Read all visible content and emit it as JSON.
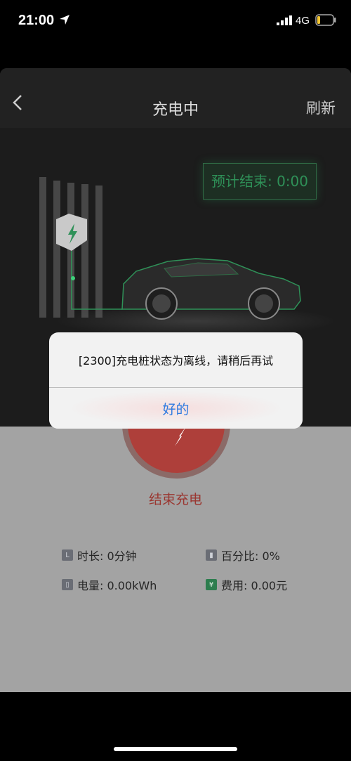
{
  "status_bar": {
    "time": "21:00",
    "network": "4G"
  },
  "nav": {
    "title": "充电中",
    "refresh_label": "刷新"
  },
  "hero": {
    "estimated_end": "预计结束: 0:00"
  },
  "control": {
    "end_charge_label": "结束充电"
  },
  "stats": {
    "duration": "时长: 0分钟",
    "percentage": "百分比: 0%",
    "energy": "电量: 0.00kWh",
    "cost": "费用: 0.00元",
    "yen_symbol": "¥"
  },
  "alert": {
    "message": "[2300]充电桩状态为离线，请稍后再试",
    "ok_label": "好的"
  },
  "colors": {
    "accent_green": "#2f9158",
    "end_red": "#ae3f3a",
    "alert_link": "#2f7be0"
  }
}
